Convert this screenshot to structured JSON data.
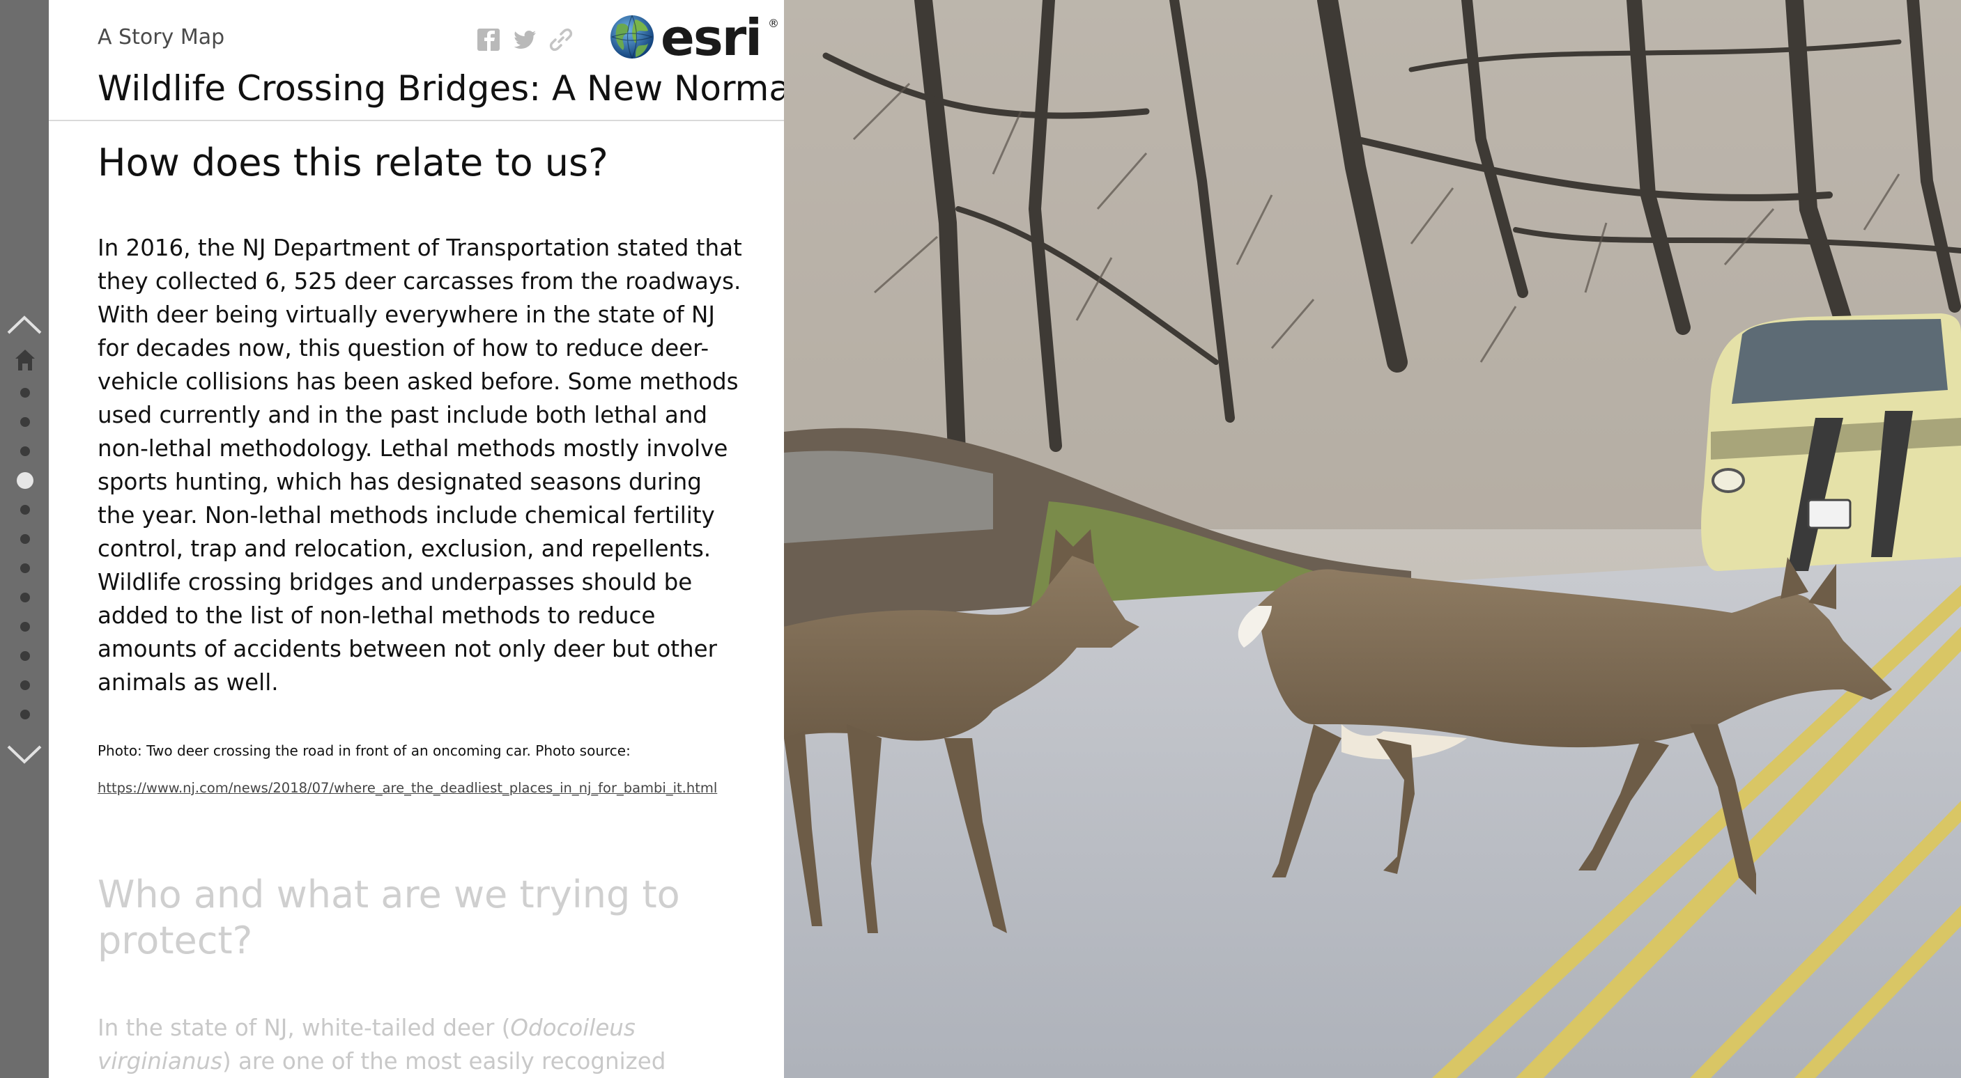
{
  "header": {
    "subtitle": "A Story Map",
    "title": "Wildlife Crossing Bridges: A New Normal",
    "share_icons": [
      "facebook-icon",
      "twitter-icon",
      "link-icon"
    ],
    "logo_text": "esri",
    "logo_mark": "®"
  },
  "nav": {
    "dot_count": 12,
    "active_index": 3
  },
  "section": {
    "heading": "How does this relate to us?",
    "body": "In 2016, the NJ Department of Transportation stated that they collected 6, 525 deer carcasses from the roadways. With deer being virtually everywhere in the state of NJ for decades now, this question of how to reduce deer-vehicle collisions has been asked before. Some methods used currently and in the past include both lethal and non-lethal methodology. Lethal methods mostly involve sports hunting, which has designated seasons during the year. Non-lethal methods include chemical fertility control, trap and relocation, exclusion, and repellents. Wildlife crossing bridges and underpasses should be added to the list of non-lethal methods to reduce amounts of accidents between not only deer but other animals as well.",
    "caption": "Photo: Two deer crossing the road in front of an oncoming car. Photo source:",
    "caption_link": "https://www.nj.com/news/2018/07/where_are_the_deadliest_places_in_nj_for_bambi_it.html"
  },
  "next_section": {
    "heading": "Who and what are we trying to protect?",
    "body_before": "In the state of NJ, white-tailed deer (",
    "body_species": "Odocoileus virginianus",
    "body_after": ") are one of the most easily recognized animal species."
  },
  "colors": {
    "nav_rail": "#6d6d6d",
    "nav_dot": "#3b3b3b",
    "nav_dot_active": "#e6e6e6",
    "faded_text": "#cfcfcf"
  }
}
